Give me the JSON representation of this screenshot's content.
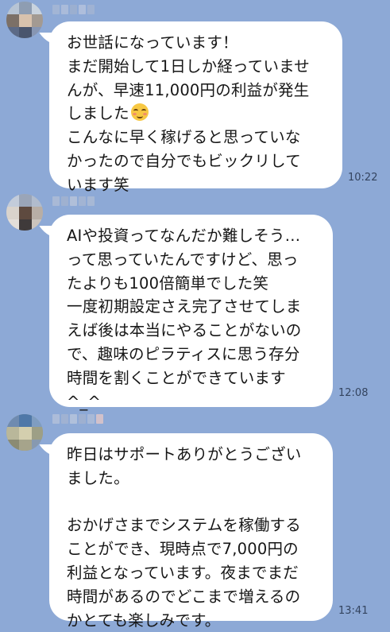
{
  "messages": [
    {
      "sender": "",
      "lines": [
        "お世話になっています！",
        "まだ開始して1日しか経っていませ",
        "んが、早速11,000円の利益が発生",
        "しました"
      ],
      "lines_after_emoji": [
        "こんなに早く稼げると思っていな",
        "かったので自分でもビックリして",
        "います笑"
      ],
      "emoji": "relieved-face-emoji",
      "time": "10:22"
    },
    {
      "sender": "",
      "text": "AIや投資ってなんだか難しそう…\nって思っていたんですけど、思っ\nたよりも100倍簡単でした笑\n一度初期設定さえ完了させてしま\nえば後は本当にやることがないの\nで、趣味のピラティスに思う存分\n時間を割くことができています\n^_^",
      "time": "12:08"
    },
    {
      "sender": "",
      "text": "昨日はサポートありがとうござい\nました。\n\nおかげさまでシステムを稼働する\nことができ、現時点で7,000円の\n利益となっています。夜までまだ\n時間があるのでどこまで増えるの\nかとても楽しみです。",
      "time": "13:41"
    }
  ],
  "colors": {
    "background": "#8da9d6",
    "bubble": "#ffffff",
    "text": "#161616",
    "timestamp": "#34445f"
  }
}
